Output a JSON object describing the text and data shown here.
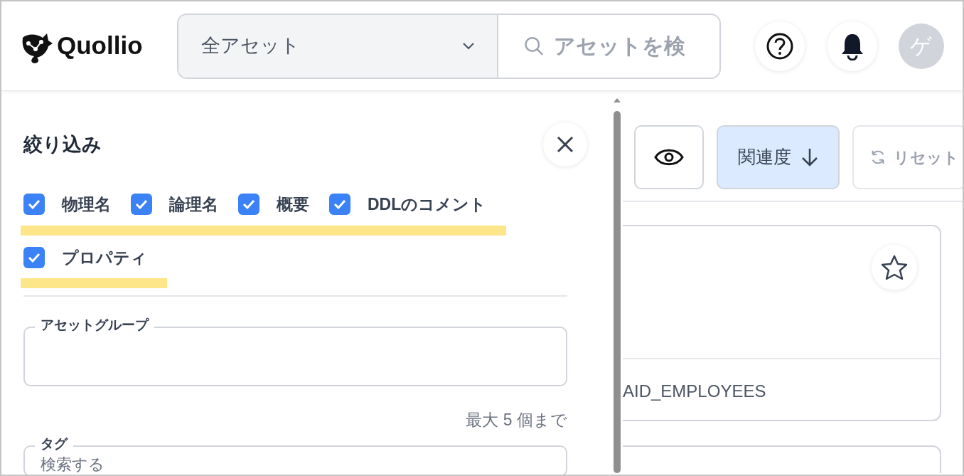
{
  "header": {
    "logo": "Quollio",
    "scope_select": {
      "value": "全アセット"
    },
    "search": {
      "placeholder": "アセットを検"
    },
    "avatar": "ゲ"
  },
  "filter_panel": {
    "title": "絞り込み",
    "options": [
      {
        "label": "物理名",
        "checked": true,
        "highlighted": true
      },
      {
        "label": "論理名",
        "checked": true,
        "highlighted": true
      },
      {
        "label": "概要",
        "checked": true,
        "highlighted": true
      },
      {
        "label": "DDLのコメント",
        "checked": true,
        "highlighted": true
      },
      {
        "label": "プロパティ",
        "checked": true,
        "highlighted": true
      }
    ],
    "asset_group": {
      "label": "アセットグループ"
    },
    "limit_note": "最大 5 個まで",
    "tag": {
      "label": "タグ",
      "placeholder": "検索する"
    }
  },
  "toolbar": {
    "sort": "関連度",
    "reset": "リセット"
  },
  "results": [
    {
      "name": "AID_EMPLOYEES",
      "starred": false
    }
  ]
}
